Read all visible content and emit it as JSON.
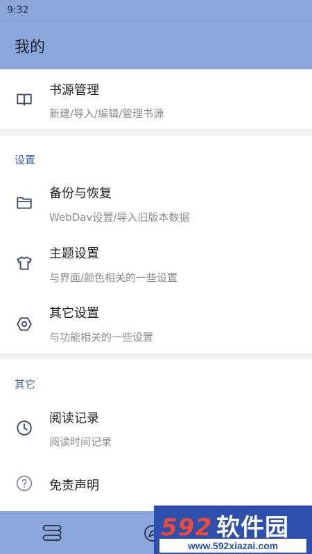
{
  "status_bar": {
    "time": "9:32"
  },
  "app_bar": {
    "title": "我的"
  },
  "book_source": {
    "title": "书源管理",
    "subtitle": "新建/导入/编辑/管理书源"
  },
  "settings": {
    "section_label": "设置",
    "items": [
      {
        "title": "备份与恢复",
        "subtitle": "WebDav设置/导入旧版本数据",
        "icon": "folder-icon"
      },
      {
        "title": "主题设置",
        "subtitle": "与界面/颜色相关的一些设置",
        "icon": "tshirt-icon"
      },
      {
        "title": "其它设置",
        "subtitle": "与功能相关的一些设置",
        "icon": "hexagon-settings-icon"
      }
    ]
  },
  "other": {
    "section_label": "其它",
    "items": [
      {
        "title": "阅读记录",
        "subtitle": "阅读时间记录",
        "icon": "clock-icon"
      },
      {
        "title": "免责声明",
        "icon": "help-circle-icon"
      }
    ]
  },
  "bottom_nav": {
    "icons": [
      "bookshelf-icon",
      "explore-icon"
    ]
  },
  "watermark": {
    "brand": "592",
    "brand_cn": "软件园",
    "url": "www.592xiazai.com"
  },
  "colors": {
    "primary": "#8aa6da",
    "accent_text": "#3f5f9d",
    "watermark_blue": "#2d4fae",
    "watermark_red": "#f04a39"
  }
}
